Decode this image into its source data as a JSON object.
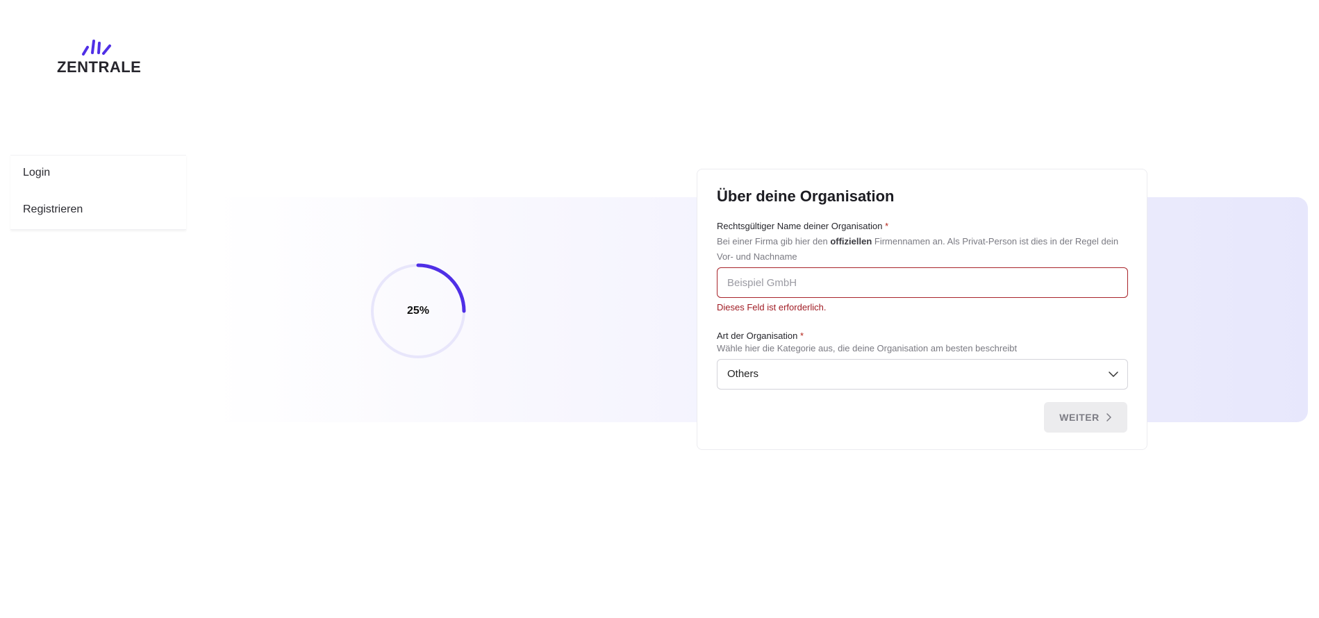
{
  "brand": {
    "name": "ZENTRALE",
    "accent": "#4f2fe6"
  },
  "sidenav": {
    "items": [
      {
        "label": "Login"
      },
      {
        "label": "Registrieren"
      }
    ]
  },
  "progress": {
    "percent": 25,
    "label": "25%",
    "track_color": "#e8e6fb",
    "fill_color": "#4f2fe6"
  },
  "form": {
    "title": "Über deine Organisation",
    "legal_name": {
      "label": "Rechtsgültiger Name deiner Organisation",
      "required_mark": "*",
      "help_prefix": "Bei einer Firma gib hier den ",
      "help_bold": "offiziellen",
      "help_suffix": " Firmennamen an. Als Privat-Person ist dies in der Regel dein Vor- und Nachname",
      "value": "",
      "placeholder": "Beispiel GmbH",
      "error": "Dieses Feld ist erforderlich."
    },
    "org_type": {
      "label": "Art der Organisation",
      "required_mark": "*",
      "help": "Wähle hier die Kategorie aus, die deine Organisation am besten beschreibt",
      "selected": "Others"
    },
    "next_button": {
      "label": "WEITER"
    }
  },
  "icons": {
    "logo": "sunrise-rays-icon",
    "select": "chevron-down-icon",
    "next": "chevron-right-icon"
  }
}
